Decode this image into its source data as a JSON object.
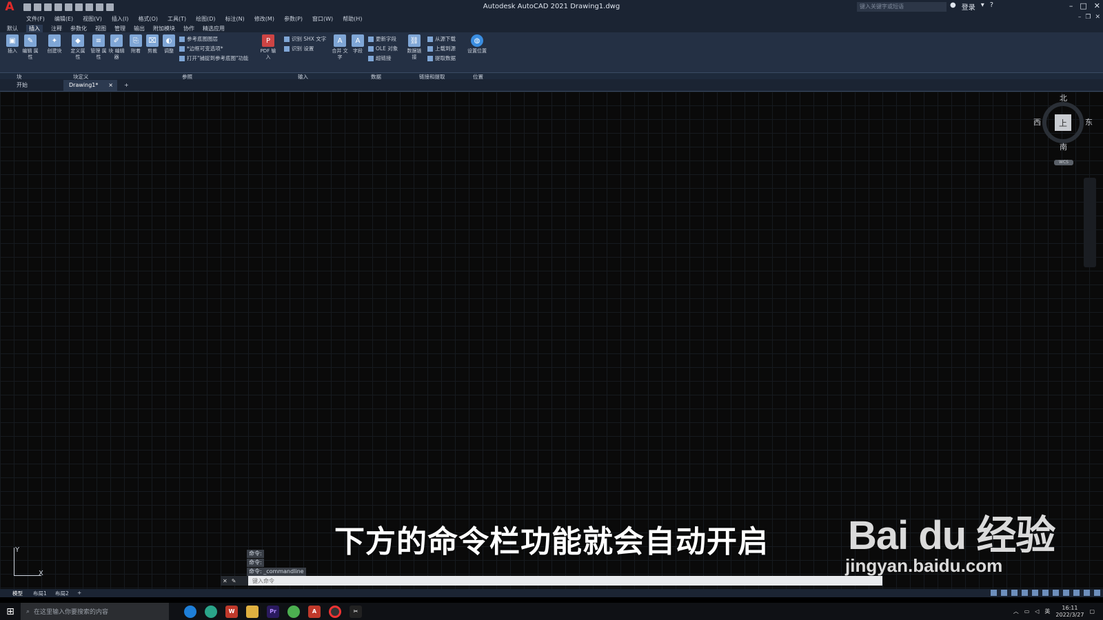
{
  "titlebar": {
    "logo": "A",
    "title": "Autodesk AutoCAD 2021    Drawing1.dwg",
    "search_placeholder": "键入关键字或短语",
    "signin": "登录",
    "help": "?"
  },
  "menubar": [
    "文件(F)",
    "编辑(E)",
    "视图(V)",
    "插入(I)",
    "格式(O)",
    "工具(T)",
    "绘图(D)",
    "标注(N)",
    "修改(M)",
    "参数(P)",
    "窗口(W)",
    "帮助(H)"
  ],
  "ribbon_tabs": [
    "默认",
    "插入",
    "注释",
    "参数化",
    "视图",
    "管理",
    "输出",
    "附加模块",
    "协作",
    "精选应用"
  ],
  "ribbon": {
    "insert": "插入",
    "edit_attr": "编辑\n属性",
    "create_block": "创建块",
    "define_attr": "定义属性",
    "manage_attr": "管理\n属性",
    "block_editor": "块\n编辑器",
    "attach": "附着",
    "clip": "剪裁",
    "adjust": "调整",
    "ref_underlay": "参考底图图层",
    "frame_variable": "*边框可变选项*",
    "snap_underlay": "打开\"捕捉到参考底图\"功能",
    "pdf_import": "PDF\n输入",
    "recognize_shx": "识别 SHX 文字",
    "recognize_settings": "识别 设置",
    "merge_text": "合并\n文字",
    "field": "字段",
    "update_field": "更新字段",
    "ole_object": "OLE 对象",
    "hyperlink": "超链接",
    "data_link": "数据链接",
    "download_source": "从源下载",
    "upload_source": "上载到源",
    "extract_data": "提取数据",
    "set_location": "设置位置"
  },
  "panels": [
    "块",
    "块定义",
    "参照",
    "输入",
    "数据",
    "链接和提取",
    "位置"
  ],
  "file_tabs": {
    "start": "开始",
    "drawing": "Drawing1*",
    "close": "×",
    "add": "+"
  },
  "viewcube": {
    "north": "北",
    "south": "南",
    "east": "东",
    "west": "西",
    "face": "上",
    "wcs": "WCS"
  },
  "ucs": {
    "x": "X",
    "y": "Y"
  },
  "command_history": [
    "命令:",
    "命令:",
    "命令:  _commandline"
  ],
  "command_line": {
    "placeholder": "键入命令"
  },
  "subtitle": "下方的命令栏功能就会自动开启",
  "watermark": {
    "main": "Bai du 经验",
    "url": "jingyan.baidu.com"
  },
  "layout_tabs": [
    "模型",
    "布局1",
    "布局2",
    "+"
  ],
  "taskbar": {
    "search_placeholder": "在这里输入你要搜索的内容",
    "apps": [
      "edge-icon",
      "edge-dev-icon",
      "wps-icon",
      "explorer-icon",
      "premiere-icon",
      "chrome-icon",
      "autocad-icon",
      "record-icon",
      "capcut-icon"
    ],
    "tray_lang": "英",
    "time": "16:11",
    "date": "2022/3/27"
  },
  "colors": {
    "accent": "#e02a2a",
    "ribbon_bg": "#243044",
    "canvas_bg": "#0a0a0a"
  }
}
